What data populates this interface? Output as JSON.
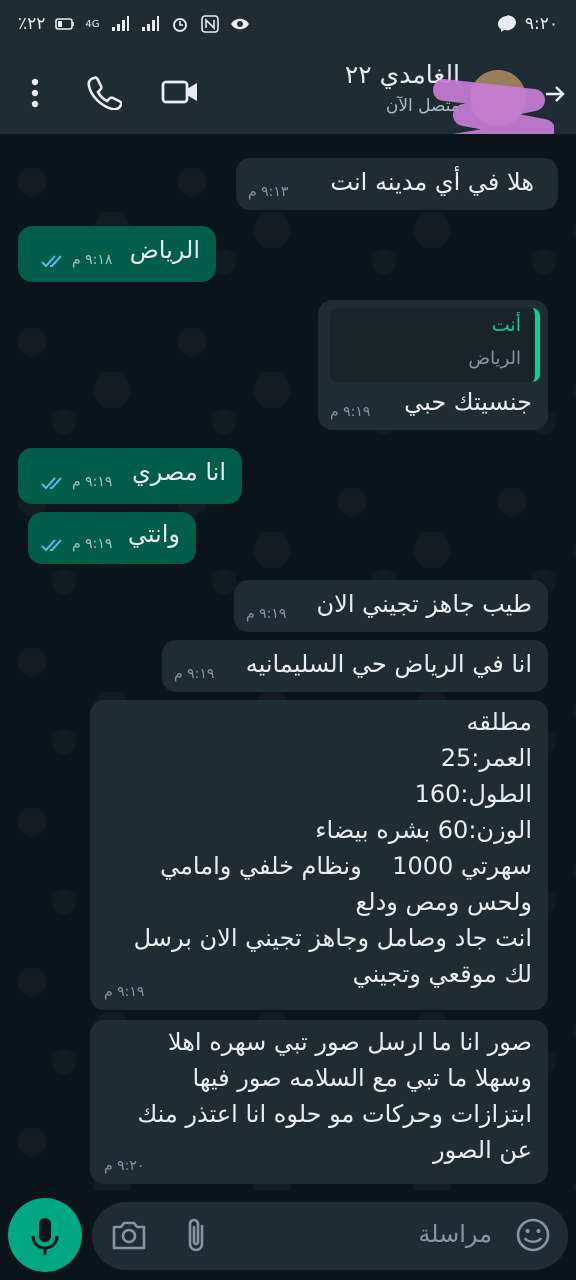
{
  "status_bar": {
    "time": "٩:٢٠",
    "battery": "٪٢٢",
    "network": "4G"
  },
  "header": {
    "contact_name": "الغامدي ٢٢",
    "presence": "متصل الآن"
  },
  "messages": [
    {
      "dir": "in",
      "text": "هلا في أي مدينه انت",
      "time": "٩:١٣ م"
    },
    {
      "dir": "out",
      "text": "الرياض",
      "time": "٩:١٨ م",
      "read": true
    },
    {
      "dir": "in",
      "quote_author": "أنت",
      "quote_text": "الرياض",
      "text": "جنسيتك حبي",
      "time": "٩:١٩ م"
    },
    {
      "dir": "out",
      "text": "انا مصري",
      "time": "٩:١٩ م",
      "read": true
    },
    {
      "dir": "out",
      "text": "وانتي",
      "time": "٩:١٩ م",
      "read": true
    },
    {
      "dir": "in",
      "text": "طيب جاهز تجيني الان",
      "time": "٩:١٩ م"
    },
    {
      "dir": "in",
      "text": "انا في الرياض حي السليمانيه",
      "time": "٩:١٩ م"
    },
    {
      "dir": "in",
      "text": "مطلقه\nالعمر:25\nالطول:160\nالوزن:60 بشره بيضاء\nسهرتي 1000    ونظام خلفي وامامي\nولحس ومص ودلع\nانت جاد وصامل وجاهز تجيني الان برسل\nلك موقعي وتجيني",
      "time": "٩:١٩ م"
    },
    {
      "dir": "in",
      "text": "صور انا ما ارسل صور تبي سهره اهلا\nوسهلا ما تبي مع السلامه صور فيها\nابتزازات وحركات مو حلوه انا اعتذر منك\nعن الصور",
      "time": "٩:٢٠ م"
    }
  ],
  "composer": {
    "placeholder": "مراسلة"
  },
  "colors": {
    "incoming_bubble": "#202c33",
    "outgoing_bubble": "#005c4b",
    "accent": "#00a884",
    "read_ticks": "#53bdeb"
  }
}
